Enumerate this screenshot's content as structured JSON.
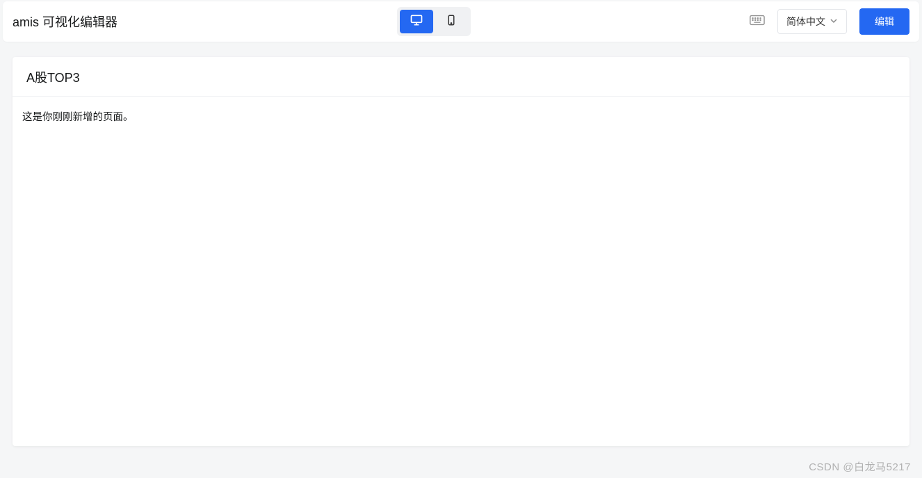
{
  "header": {
    "app_title": "amis 可视化编辑器",
    "language_label": "简体中文",
    "edit_button_label": "编辑"
  },
  "page": {
    "title": "A股TOP3",
    "body_text": "这是你刚刚新增的页面。"
  },
  "watermark": "CSDN @白龙马5217"
}
